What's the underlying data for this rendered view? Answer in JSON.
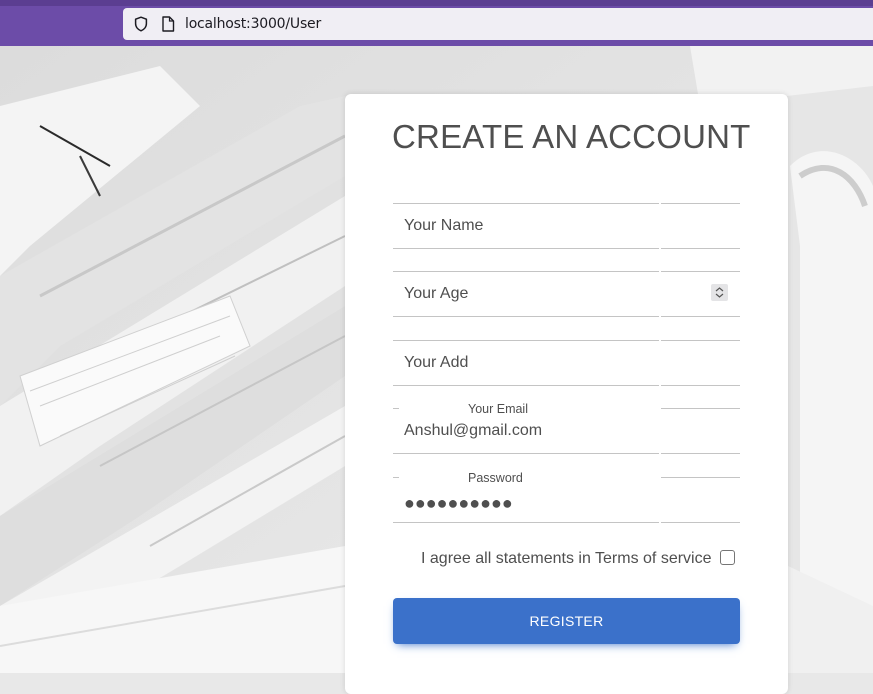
{
  "browser": {
    "url_host": "localhost",
    "url_rest": ":3000/User"
  },
  "form": {
    "title": "CREATE AN ACCOUNT",
    "name": {
      "placeholder": "Your Name",
      "value": ""
    },
    "age": {
      "placeholder": "Your Age",
      "value": ""
    },
    "address": {
      "placeholder": "Your Add",
      "value": ""
    },
    "email": {
      "label": "Your Email",
      "value": "Anshul@gmail.com"
    },
    "password": {
      "label": "Password",
      "masked": "●●●●●●●●●●"
    },
    "terms_label": "I agree all statements in Terms of service",
    "terms_checked": false,
    "register_label": "REGISTER"
  },
  "colors": {
    "chrome": "#6c4ca8",
    "button": "#3b71ca",
    "text": "#4f4f4f"
  },
  "icons": {
    "tracking_protection": "shield-icon",
    "page_info": "page-icon",
    "number_spinner": "spinner-icon"
  }
}
